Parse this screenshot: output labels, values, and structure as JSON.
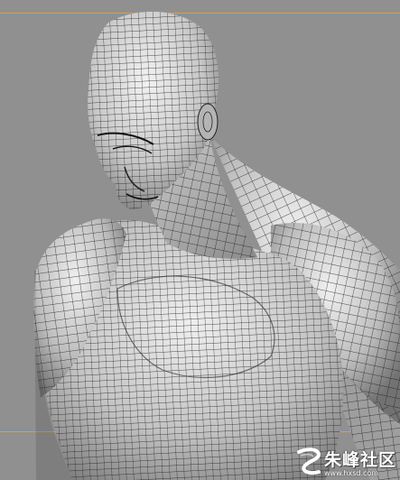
{
  "viewport": {
    "background": "#909090",
    "safe_frame_color": "#d9a23a",
    "wireframe_color": "#1c1c1c",
    "shading_light": "#ececec",
    "shading_dark": "#7a7a7a"
  },
  "watermark": {
    "title": "朱峰社区",
    "subtitle": "www.hxsd.com",
    "icon": "swirl-logo-icon"
  }
}
